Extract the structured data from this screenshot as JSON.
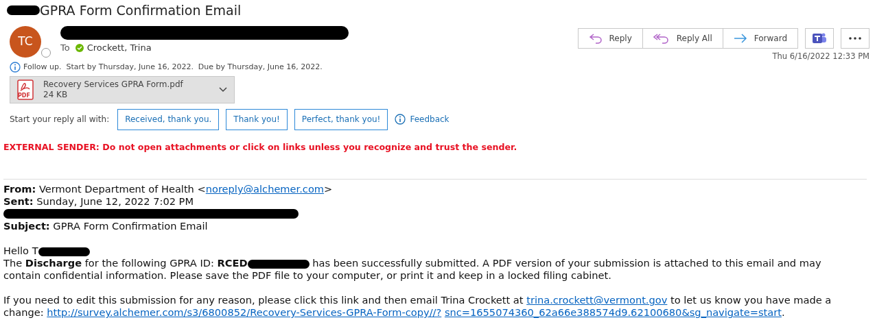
{
  "subject_title": "GPRA Form Confirmation Email",
  "sender": {
    "initials": "TC"
  },
  "to_label": "To",
  "recipients": [
    {
      "name": "Crockett, Trina"
    }
  ],
  "follow_up": "Follow up.  Start by Thursday, June 16, 2022.  Due by Thursday, June 16, 2022.",
  "actions": [
    {
      "kind": "reply",
      "label": "Reply"
    },
    {
      "kind": "reply-all",
      "label": "Reply All"
    },
    {
      "kind": "forward",
      "label": "Forward"
    },
    {
      "kind": "teams"
    },
    {
      "kind": "more"
    }
  ],
  "received": "Thu 6/16/2022 12:33 PM",
  "attachment": {
    "name": "Recovery Services GPRA Form.pdf",
    "size": "24 KB",
    "icon_label": "PDF"
  },
  "quick_replies": {
    "prompt": "Start your reply all with:",
    "options": [
      "Received, thank you.",
      "Thank you!",
      "Perfect, thank you!"
    ],
    "feedback": "Feedback"
  },
  "warning": "EXTERNAL SENDER: Do not open attachments or click on links unless you recognize and trust the sender.",
  "headers": [
    {
      "kind": "field",
      "label": "From:",
      "segments": [
        {
          "kind": "text",
          "text": "Vermont Department of Health <"
        },
        {
          "kind": "link",
          "text": "noreply@alchemer.com"
        },
        {
          "kind": "text",
          "text": ">"
        }
      ]
    },
    {
      "kind": "field",
      "label": "Sent:",
      "segments": [
        {
          "kind": "text",
          "text": "Sunday, June 12, 2022 7:02 PM"
        }
      ]
    },
    {
      "kind": "redacted"
    },
    {
      "kind": "field",
      "label": "Subject:",
      "segments": [
        {
          "kind": "text",
          "text": "GPRA Form Confirmation Email"
        }
      ]
    }
  ],
  "body": [
    [
      {
        "kind": "text",
        "text": "Hello T"
      },
      {
        "kind": "redacted"
      }
    ],
    [
      {
        "kind": "text",
        "text": "The **Discharge** for the following GPRA ID: **RCED**"
      },
      {
        "kind": "redacted"
      },
      {
        "kind": "text",
        "text": " has been successfully submitted. A PDF version of your submission is attached to this email and may contain confidential information. Please save the PDF file to your computer, or print it and keep in a locked filing cabinet."
      }
    ],
    [
      {
        "kind": "gap"
      }
    ],
    [
      {
        "kind": "text",
        "text": "If you need to edit this submission for any reason, please click this link and then email Trina Crockett at"
      },
      {
        "kind": "link",
        "text": "trina.crockett@vermont.gov"
      },
      {
        "kind": "text",
        "text": "to let us know you have made a change:"
      },
      {
        "kind": "link",
        "text": "http://survey.alchemer.com/s3/6800852/Recovery-Services-GPRA-Form-copy//?"
      },
      {
        "kind": "link",
        "text": "snc=1655074360_62a66e388574d9.62100680&sg_navigate=start"
      },
      {
        "kind": "text",
        "text": "."
      }
    ]
  ]
}
